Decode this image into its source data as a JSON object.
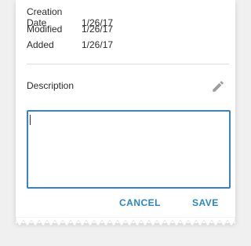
{
  "details": {
    "rows": [
      {
        "label": "Creation Date",
        "value": "1/26/17"
      },
      {
        "label": "Modified",
        "value": "1/26/17"
      },
      {
        "label": "Added",
        "value": "1/26/17"
      }
    ]
  },
  "description": {
    "label": "Description",
    "value": ""
  },
  "actions": {
    "cancel_label": "CANCEL",
    "save_label": "SAVE"
  },
  "colors": {
    "accent": "#2a86c7",
    "focus_border": "#3b82c4",
    "text": "#2b2b2b",
    "icon": "#9e9e9e"
  },
  "icons": {
    "edit": "pencil-icon"
  }
}
